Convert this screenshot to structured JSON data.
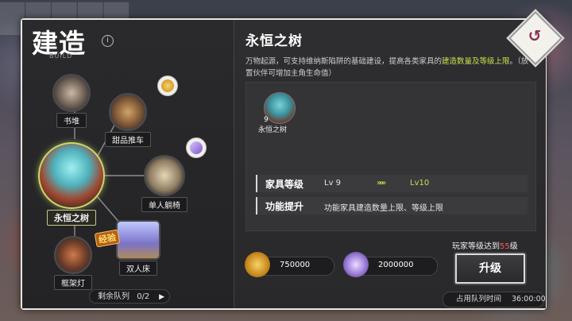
{
  "panel": {
    "title": "建造",
    "subtitle": "BUILD",
    "info_icon": "i",
    "queue_label": "剩余队列",
    "queue_value": "0/2"
  },
  "nodes": [
    {
      "id": "books",
      "label": "书堆",
      "icon": "book-stack-icon"
    },
    {
      "id": "dessert",
      "label": "甜品推车",
      "icon": "dessert-cart-icon"
    },
    {
      "id": "tree",
      "label": "永恒之树",
      "icon": "eternal-tree-icon",
      "selected": true
    },
    {
      "id": "chair",
      "label": "单人躺椅",
      "icon": "lounge-chair-icon"
    },
    {
      "id": "bed",
      "label": "双人床",
      "icon": "double-bed-icon",
      "badge": "经验"
    },
    {
      "id": "lamp",
      "label": "框架灯",
      "icon": "frame-lamp-icon"
    }
  ],
  "detail": {
    "title": "永恒之树",
    "desc_part1": "万物起源，可支持维纳斯陷阱的基础建设，提高各类家具的",
    "desc_highlight": "建造数量及等级上限",
    "desc_part2": "。（放置伙伴可增加主角生命值）",
    "thumb_level": "9",
    "thumb_name": "永恒之树",
    "level_key": "家具等级",
    "level_from": "Lv 9",
    "level_arrow": "»»»",
    "level_to": "Lv10",
    "func_key": "功能提升",
    "func_value": "功能家具建造数量上限、等级上限"
  },
  "costs": [
    {
      "icon": "gold-coin-icon",
      "amount": "750000",
      "color": "#d99a22"
    },
    {
      "icon": "purple-crystal-icon",
      "amount": "2000000",
      "color": "#9a7ad8"
    }
  ],
  "requirement": {
    "prefix": "玩家等级达到",
    "level": "55",
    "suffix": "级"
  },
  "upgrade_label": "升级",
  "time": {
    "label": "占用队列时间",
    "value": "36:00:00"
  },
  "back_glyph": "↺",
  "colors": {
    "accent": "#c6e04c",
    "warning": "#ff5a4e"
  }
}
